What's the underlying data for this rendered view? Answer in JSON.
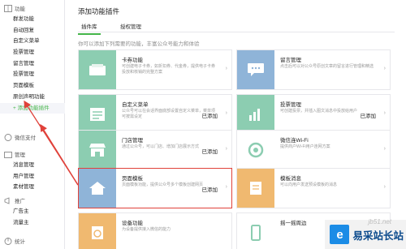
{
  "sidebar": {
    "sections": [
      {
        "head": "功能",
        "items": [
          "群发功能",
          "自动回复",
          "自定义菜单",
          "投票管理",
          "留言管理",
          "投票管理",
          "页面模板",
          "原创声明功能",
          "+ 添加功能插件"
        ]
      },
      {
        "head": "微信支付",
        "items": []
      },
      {
        "head": "管理",
        "items": [
          "消息管理",
          "用户管理",
          "素材管理"
        ]
      },
      {
        "head": "推广",
        "items": [
          "广告主",
          "流量主"
        ]
      },
      {
        "head": "统计",
        "items": []
      }
    ]
  },
  "main": {
    "title": "添加功能插件",
    "tabs": [
      "插件库",
      "授权管理"
    ],
    "intro": "你可以添加下列需要的功能，丰富公众号能力和体验"
  },
  "cards": [
    {
      "name": "卡券功能",
      "desc": "可创建电子卡券，如折扣券、代金券，提供电子卡券投放和核销的完整方案",
      "status": "",
      "color": "#8ccdb1"
    },
    {
      "name": "留言管理",
      "desc": "点击后可以对公众号原创文章的留言进行管理和精选",
      "status": "",
      "color": "#8fb4d8"
    },
    {
      "name": "自定义菜单",
      "desc": "公众号可以在会话界面底部设置自定义菜单，菜单项可按需设定",
      "status": "已添加",
      "color": "#8ccdb1"
    },
    {
      "name": "投票管理",
      "desc": "可创建投票，并插入图文消息中投放给用户",
      "status": "已添加",
      "color": "#8ccdb1"
    },
    {
      "name": "门店管理",
      "desc": "通过公众号，可以门店、增加门店展示方式",
      "status": "已添加",
      "color": "#8ccdb1"
    },
    {
      "name": "微信连Wi-Fi",
      "desc": "提供商户Wi-Fi用户连网方案",
      "status": "",
      "color": "#8ccdb1"
    },
    {
      "name": "页面模板",
      "desc": "页面模板功能，提供公众号多个模板创建网页",
      "status": "已添加",
      "color": "#8fb4d8"
    },
    {
      "name": "模板消息",
      "desc": "可以向用户发送预设模板的消息",
      "status": "",
      "color": "#f0b970"
    },
    {
      "name": "设备功能",
      "desc": "为设备提供接入微信的能力",
      "status": "",
      "color": "#f0b970"
    },
    {
      "name": "摇一摇周边",
      "desc": "在线下场景通过摇一摇连接",
      "status": "",
      "color": "#8ccdb1"
    }
  ],
  "watermark": {
    "brand": "易采站长站",
    "url": "jb51.net",
    "logo": "e"
  }
}
